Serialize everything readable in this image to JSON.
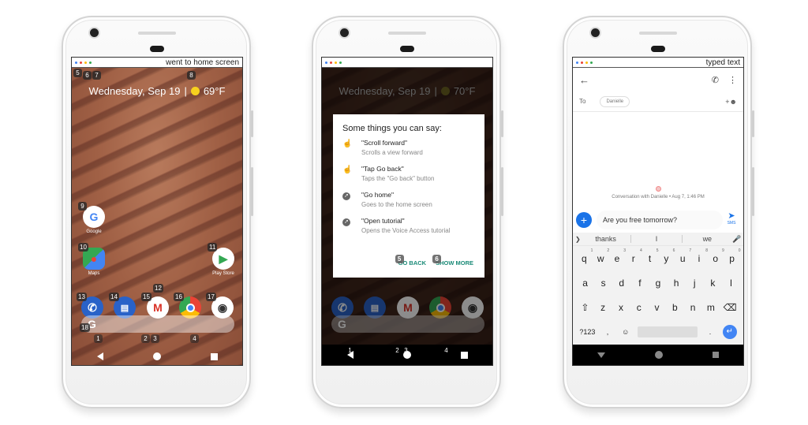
{
  "phones": [
    {
      "status_text": "went to home screen",
      "date": "Wednesday, Sep 19",
      "temperature": "69°F",
      "badges": {
        "b5": "5",
        "b6": "6",
        "b7": "7",
        "b8": "8",
        "b9": "9",
        "b10": "10",
        "b11": "11",
        "b12": "12",
        "b13": "13",
        "b14": "14",
        "b15": "15",
        "b16": "16",
        "b17": "17",
        "b18": "18",
        "b1": "1",
        "b2": "2",
        "b3": "3",
        "b4": "4"
      },
      "apps": {
        "google": "Google",
        "maps": "Maps",
        "play_store": "Play Store"
      },
      "search_glyph": "G"
    },
    {
      "status_text": "",
      "date": "Wednesday, Sep 19",
      "temperature": "70°F",
      "dialog": {
        "title": "Some things you can say:",
        "commands": [
          {
            "phrase": "\"Scroll  forward\"",
            "desc": "Scrolls a view forward",
            "icon": "touch-icon"
          },
          {
            "phrase": "\"Tap Go back\"",
            "desc": "Taps the \"Go back\" button",
            "icon": "touch-icon"
          },
          {
            "phrase": "\"Go home\"",
            "desc": "Goes to the home screen",
            "icon": "compass-icon"
          },
          {
            "phrase": "\"Open tutorial\"",
            "desc": "Opens the Voice Access tutorial",
            "icon": "compass-icon"
          }
        ],
        "go_back": "GO BACK",
        "show_more": "SHOW MORE",
        "go_back_badge": "5",
        "show_more_badge": "6"
      },
      "badges": {
        "b1": "1",
        "b2": "2",
        "b3": "3",
        "b4": "4"
      },
      "search_glyph": "G"
    },
    {
      "status_text": "typed text",
      "to_label": "To",
      "recipient": "Danielle",
      "conversation_info": "Conversation with Danielle • Aug 7, 1:46 PM",
      "message_text": "Are you free tomorrow?",
      "send_label": "SMS",
      "suggestions": [
        "thanks",
        "I",
        "we"
      ],
      "keyboard": {
        "row1": [
          {
            "k": "q",
            "n": "1"
          },
          {
            "k": "w",
            "n": "2"
          },
          {
            "k": "e",
            "n": "3"
          },
          {
            "k": "r",
            "n": "4"
          },
          {
            "k": "t",
            "n": "5"
          },
          {
            "k": "y",
            "n": "6"
          },
          {
            "k": "u",
            "n": "7"
          },
          {
            "k": "i",
            "n": "8"
          },
          {
            "k": "o",
            "n": "9"
          },
          {
            "k": "p",
            "n": "0"
          }
        ],
        "row2": [
          "a",
          "s",
          "d",
          "f",
          "g",
          "h",
          "j",
          "k",
          "l"
        ],
        "row3": [
          "z",
          "x",
          "c",
          "v",
          "b",
          "n",
          "m"
        ],
        "symbols": "?123",
        "comma": ",",
        "period": "."
      }
    }
  ],
  "colors": {
    "dot_blue": "#4285f4",
    "dot_red": "#ea4335",
    "dot_yellow": "#fbbc05",
    "dot_green": "#34a853",
    "accent_teal": "#1a8a77",
    "accent_blue": "#1a73e8"
  }
}
